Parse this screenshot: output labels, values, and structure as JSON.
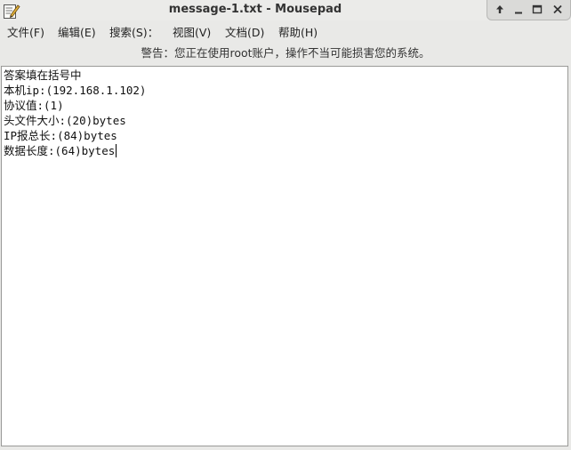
{
  "window": {
    "title": "message-1.txt - Mousepad",
    "app_icon": "text-editor-icon",
    "controls": [
      "keep-above-icon",
      "minimize-icon",
      "maximize-icon",
      "close-icon"
    ]
  },
  "menubar": {
    "items": [
      {
        "label": "文件(F)"
      },
      {
        "label": "编辑(E)"
      },
      {
        "label": "搜索(S)："
      },
      {
        "label": "视图(V)"
      },
      {
        "label": "文档(D)"
      },
      {
        "label": "帮助(H)"
      }
    ]
  },
  "warning": {
    "text": "警告：您正在使用root账户，操作不当可能损害您的系统。"
  },
  "editor": {
    "lines": [
      "答案填在括号中",
      "本机ip:(192.168.1.102)",
      "协议值:(1)",
      "头文件大小:(20)bytes",
      "IP报总长:(84)bytes",
      "数据长度:(64)bytes"
    ]
  }
}
